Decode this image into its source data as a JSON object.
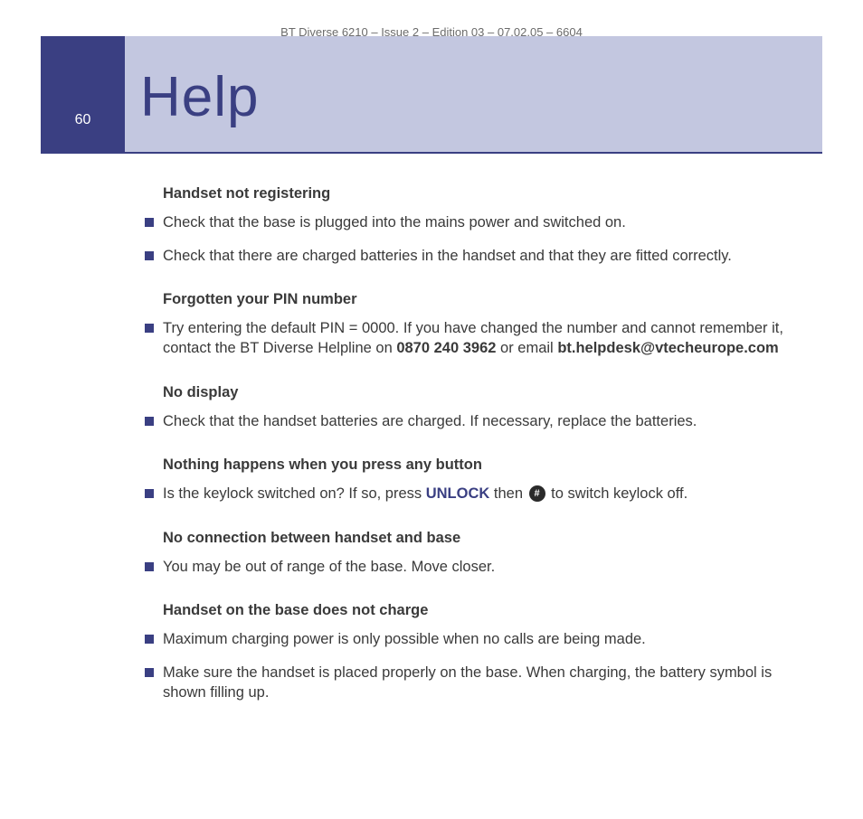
{
  "header": "BT Diverse 6210 – Issue 2 – Edition 03 – 07.02.05 – 6604",
  "page_number": "60",
  "title": "Help",
  "sections": [
    {
      "heading": "Handset not registering",
      "items": [
        {
          "text": "Check that the base is plugged into the mains power and switched on."
        },
        {
          "text": "Check that there are charged batteries in the handset and that they are fitted correctly."
        }
      ]
    },
    {
      "heading": "Forgotten your PIN number",
      "items": [
        {
          "prefix": "Try entering the default PIN = 0000. If you have changed the number and cannot remember it, contact the BT Diverse Helpline on ",
          "bold1": "0870 240 3962",
          "mid": " or email ",
          "bold2": "bt.helpdesk@vtecheurope.com"
        }
      ]
    },
    {
      "heading": "No display",
      "items": [
        {
          "text": "Check that the handset batteries are charged. If necessary, replace the batteries."
        }
      ]
    },
    {
      "heading": "Nothing happens when you press any button",
      "items": [
        {
          "prefix": "Is the keylock switched on? If so, press ",
          "unlock": "UNLOCK",
          "mid": " then ",
          "icon": "#",
          "suffix": " to switch keylock off."
        }
      ]
    },
    {
      "heading": "No connection between handset and base",
      "items": [
        {
          "text": "You may be out of range of the base. Move closer."
        }
      ]
    },
    {
      "heading": "Handset on the base does not charge",
      "items": [
        {
          "text": "Maximum charging power is only possible when no calls are being made."
        },
        {
          "text": "Make sure the handset is placed properly on the base. When charging, the battery symbol is shown filling up."
        }
      ]
    }
  ]
}
